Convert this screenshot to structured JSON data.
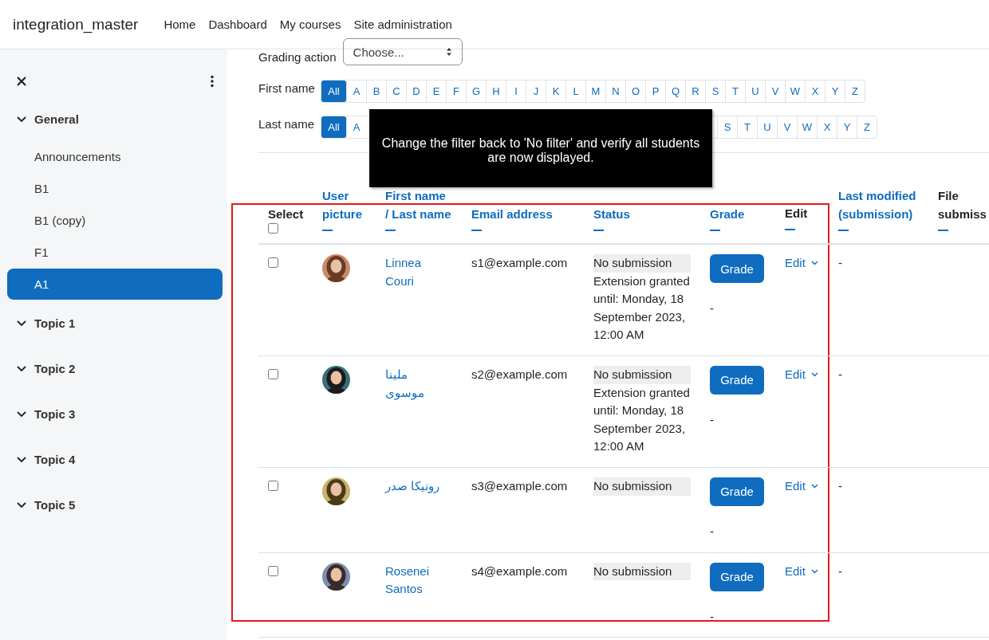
{
  "navbar": {
    "site_name": "integration_master",
    "links": [
      "Home",
      "Dashboard",
      "My courses",
      "Site administration"
    ]
  },
  "sidebar": {
    "sections": [
      {
        "label": "General",
        "children": [
          {
            "label": "Announcements",
            "selected": false
          },
          {
            "label": "B1",
            "selected": false
          },
          {
            "label": "B1 (copy)",
            "selected": false
          },
          {
            "label": "F1",
            "selected": false
          },
          {
            "label": "A1",
            "selected": true
          }
        ]
      },
      {
        "label": "Topic 1"
      },
      {
        "label": "Topic 2"
      },
      {
        "label": "Topic 3"
      },
      {
        "label": "Topic 4"
      },
      {
        "label": "Topic 5"
      }
    ]
  },
  "grading_action": {
    "label": "Grading action",
    "value": "Choose..."
  },
  "filters": [
    {
      "label": "First name",
      "letters": [
        {
          "text": "All",
          "selected": true
        },
        {
          "text": "A",
          "selected": false
        },
        {
          "text": "B",
          "selected": false
        },
        {
          "text": "C",
          "selected": false
        },
        {
          "text": "D",
          "selected": false
        },
        {
          "text": "E",
          "selected": false
        },
        {
          "text": "F",
          "selected": false
        },
        {
          "text": "G",
          "selected": false
        },
        {
          "text": "H",
          "selected": false
        },
        {
          "text": "I",
          "selected": false
        },
        {
          "text": "J",
          "selected": false
        },
        {
          "text": "K",
          "selected": false
        },
        {
          "text": "L",
          "selected": false
        },
        {
          "text": "M",
          "selected": false
        },
        {
          "text": "N",
          "selected": false
        },
        {
          "text": "O",
          "selected": false
        },
        {
          "text": "P",
          "selected": false
        },
        {
          "text": "Q",
          "selected": false
        },
        {
          "text": "R",
          "selected": false
        },
        {
          "text": "S",
          "selected": false
        },
        {
          "text": "T",
          "selected": false
        },
        {
          "text": "U",
          "selected": false
        },
        {
          "text": "V",
          "selected": false
        },
        {
          "text": "W",
          "selected": false
        },
        {
          "text": "X",
          "selected": false
        },
        {
          "text": "Y",
          "selected": false
        },
        {
          "text": "Z",
          "selected": false
        }
      ]
    },
    {
      "label": "Last name",
      "letters": [
        {
          "text": "All",
          "selected": true
        },
        {
          "text": "A",
          "selected": false,
          "covered_after": true
        },
        {
          "text": "S",
          "selected": false
        },
        {
          "text": "T",
          "selected": false
        },
        {
          "text": "U",
          "selected": false
        },
        {
          "text": "V",
          "selected": false
        },
        {
          "text": "W",
          "selected": false
        },
        {
          "text": "X",
          "selected": false
        },
        {
          "text": "Y",
          "selected": false
        },
        {
          "text": "Z",
          "selected": false
        }
      ]
    }
  ],
  "tooltip": "Change the filter back to 'No filter' and verify all students are now displayed.",
  "table": {
    "columns": [
      {
        "lines": [
          "Select"
        ],
        "linked": false,
        "select_all": {
          "checked": false
        }
      },
      {
        "lines": [
          "User",
          "picture"
        ],
        "linked": true
      },
      {
        "lines": [
          "First name",
          "/ Last name"
        ],
        "linked": true
      },
      {
        "lines": [
          "Email address"
        ],
        "linked": true
      },
      {
        "lines": [
          "Status"
        ],
        "linked": true
      },
      {
        "lines": [
          "Grade"
        ],
        "linked": true
      },
      {
        "lines": [
          "Edit"
        ],
        "linked": false
      },
      {
        "lines": [
          "Last modified",
          "(submission)"
        ],
        "linked": true
      },
      {
        "lines": [
          "File",
          "submiss"
        ],
        "linked": false
      }
    ],
    "rows": [
      {
        "checked": false,
        "name": "Linnea Couri",
        "email": "s1@example.com",
        "status": "No submission",
        "extension": "Extension granted until: Monday, 18 September 2023, 12:00 AM",
        "grade_button": "Grade",
        "grade": "-",
        "edit": "Edit",
        "last_modified": "-"
      },
      {
        "checked": false,
        "name": "ملینا موسوی",
        "email": "s2@example.com",
        "status": "No submission",
        "extension": "Extension granted until: Monday, 18 September 2023, 12:00 AM",
        "grade_button": "Grade",
        "grade": "-",
        "edit": "Edit",
        "last_modified": "-"
      },
      {
        "checked": false,
        "name": "رونیکا صدر",
        "email": "s3@example.com",
        "status": "No submission",
        "grade_button": "Grade",
        "grade": "-",
        "edit": "Edit",
        "last_modified": "-"
      },
      {
        "checked": false,
        "name": "Rosenei Santos",
        "email": "s4@example.com",
        "status": "No submission",
        "grade_button": "Grade",
        "grade": "-",
        "edit": "Edit",
        "last_modified": "-"
      }
    ]
  }
}
